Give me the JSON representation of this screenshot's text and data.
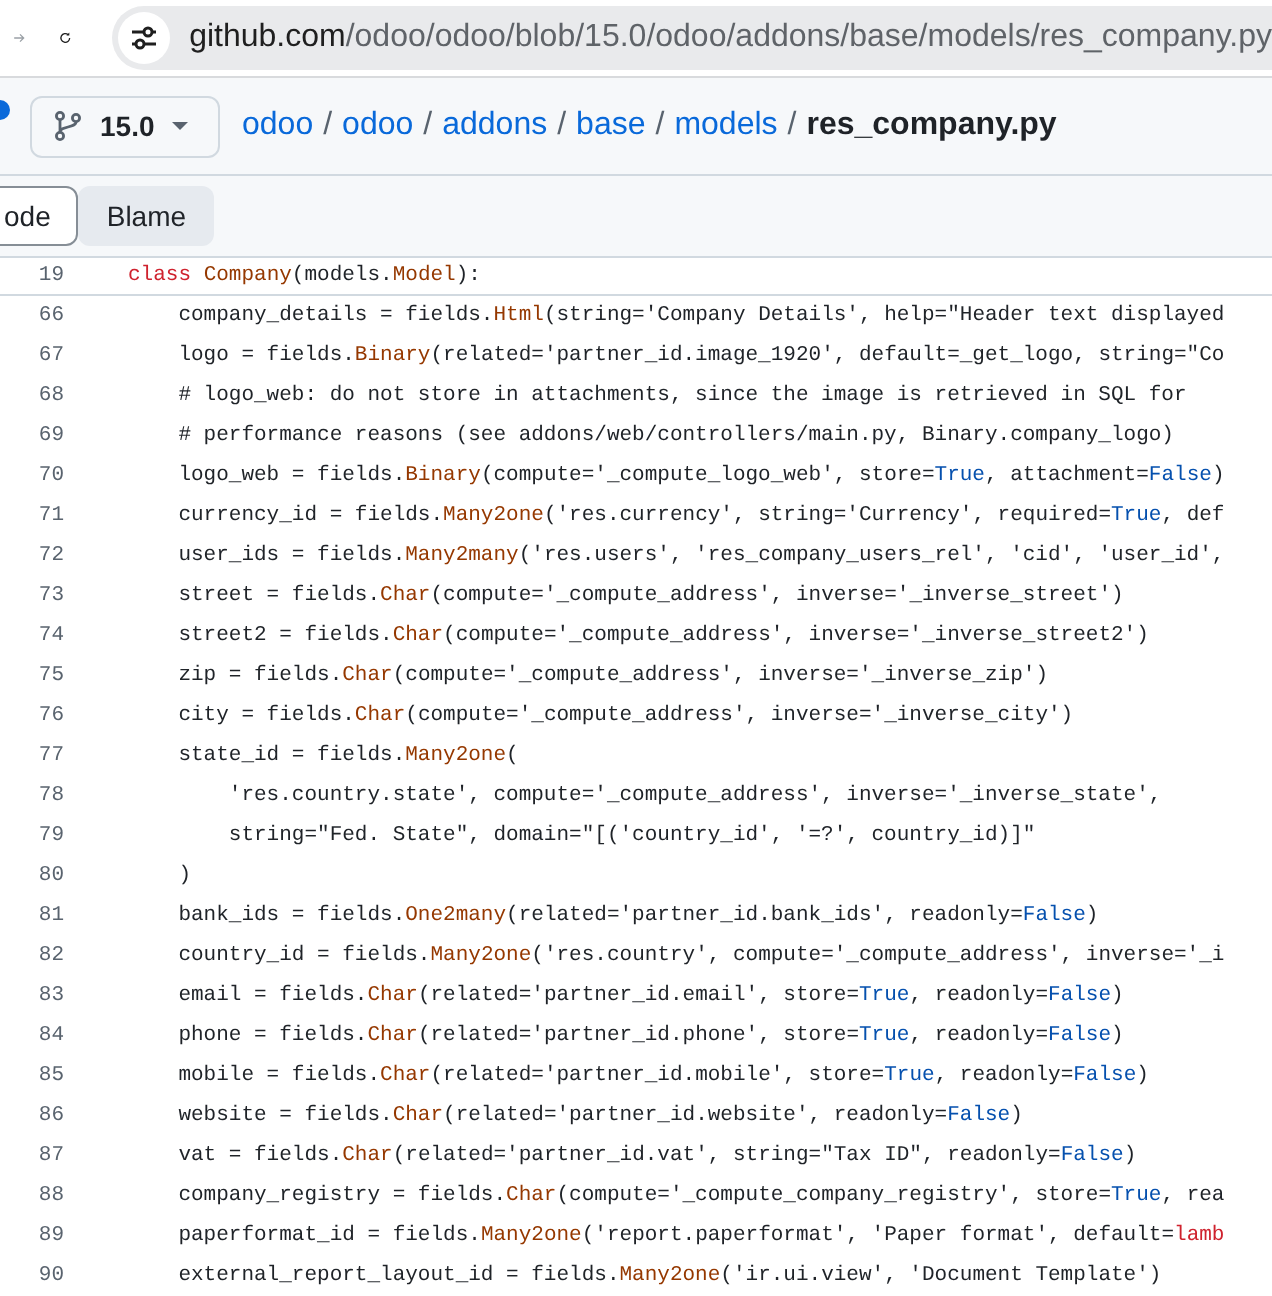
{
  "browser": {
    "host": "github.com",
    "path": "/odoo/odoo/blob/15.0/odoo/addons/base/models/res_company.py"
  },
  "repo_header": {
    "branch": "15.0",
    "separator": "/",
    "breadcrumb": [
      {
        "label": "odoo",
        "kind": "link"
      },
      {
        "label": "odoo",
        "kind": "link"
      },
      {
        "label": "addons",
        "kind": "link"
      },
      {
        "label": "base",
        "kind": "link"
      },
      {
        "label": "models",
        "kind": "link"
      },
      {
        "label": "res_company.py",
        "kind": "current"
      }
    ]
  },
  "tabs": [
    {
      "label": "ode",
      "selected": true
    },
    {
      "label": "Blame",
      "selected": false
    }
  ],
  "sticky_line": {
    "number": "19",
    "tokens": [
      {
        "kind": "keyword",
        "text": "class "
      },
      {
        "kind": "function",
        "text": "Company"
      },
      {
        "kind": "plain",
        "text": "(models."
      },
      {
        "kind": "function",
        "text": "Model"
      },
      {
        "kind": "plain",
        "text": "):"
      }
    ]
  },
  "code_lines": [
    {
      "number": "66",
      "tokens": [
        {
          "kind": "plain",
          "text": "    company_details = fields."
        },
        {
          "kind": "function",
          "text": "Html"
        },
        {
          "kind": "plain",
          "text": "(string='Company Details', help=\"Header text displayed"
        }
      ]
    },
    {
      "number": "67",
      "tokens": [
        {
          "kind": "plain",
          "text": "    logo = fields."
        },
        {
          "kind": "function",
          "text": "Binary"
        },
        {
          "kind": "plain",
          "text": "(related='partner_id.image_1920', default=_get_logo, string=\"Co"
        }
      ]
    },
    {
      "number": "68",
      "tokens": [
        {
          "kind": "plain",
          "text": "    # logo_web: do not store in attachments, since the image is retrieved in SQL for"
        }
      ]
    },
    {
      "number": "69",
      "tokens": [
        {
          "kind": "plain",
          "text": "    # performance reasons (see addons/web/controllers/main.py, Binary.company_logo)"
        }
      ]
    },
    {
      "number": "70",
      "tokens": [
        {
          "kind": "plain",
          "text": "    logo_web = fields."
        },
        {
          "kind": "function",
          "text": "Binary"
        },
        {
          "kind": "plain",
          "text": "(compute='_compute_logo_web', store="
        },
        {
          "kind": "constant",
          "text": "True"
        },
        {
          "kind": "plain",
          "text": ", attachment="
        },
        {
          "kind": "constant",
          "text": "False"
        },
        {
          "kind": "plain",
          "text": ")"
        }
      ]
    },
    {
      "number": "71",
      "tokens": [
        {
          "kind": "plain",
          "text": "    currency_id = fields."
        },
        {
          "kind": "function",
          "text": "Many2one"
        },
        {
          "kind": "plain",
          "text": "('res.currency', string='Currency', required="
        },
        {
          "kind": "constant",
          "text": "True"
        },
        {
          "kind": "plain",
          "text": ", def"
        }
      ]
    },
    {
      "number": "72",
      "tokens": [
        {
          "kind": "plain",
          "text": "    user_ids = fields."
        },
        {
          "kind": "function",
          "text": "Many2many"
        },
        {
          "kind": "plain",
          "text": "('res.users', 'res_company_users_rel', 'cid', 'user_id',"
        }
      ]
    },
    {
      "number": "73",
      "tokens": [
        {
          "kind": "plain",
          "text": "    street = fields."
        },
        {
          "kind": "function",
          "text": "Char"
        },
        {
          "kind": "plain",
          "text": "(compute='_compute_address', inverse='_inverse_street')"
        }
      ]
    },
    {
      "number": "74",
      "tokens": [
        {
          "kind": "plain",
          "text": "    street2 = fields."
        },
        {
          "kind": "function",
          "text": "Char"
        },
        {
          "kind": "plain",
          "text": "(compute='_compute_address', inverse='_inverse_street2')"
        }
      ]
    },
    {
      "number": "75",
      "tokens": [
        {
          "kind": "plain",
          "text": "    zip = fields."
        },
        {
          "kind": "function",
          "text": "Char"
        },
        {
          "kind": "plain",
          "text": "(compute='_compute_address', inverse='_inverse_zip')"
        }
      ]
    },
    {
      "number": "76",
      "tokens": [
        {
          "kind": "plain",
          "text": "    city = fields."
        },
        {
          "kind": "function",
          "text": "Char"
        },
        {
          "kind": "plain",
          "text": "(compute='_compute_address', inverse='_inverse_city')"
        }
      ]
    },
    {
      "number": "77",
      "tokens": [
        {
          "kind": "plain",
          "text": "    state_id = fields."
        },
        {
          "kind": "function",
          "text": "Many2one"
        },
        {
          "kind": "plain",
          "text": "("
        }
      ]
    },
    {
      "number": "78",
      "tokens": [
        {
          "kind": "plain",
          "text": "        'res.country.state', compute='_compute_address', inverse='_inverse_state',"
        }
      ]
    },
    {
      "number": "79",
      "tokens": [
        {
          "kind": "plain",
          "text": "        string=\"Fed. State\", domain=\"[('country_id', '=?', country_id)]\""
        }
      ]
    },
    {
      "number": "80",
      "tokens": [
        {
          "kind": "plain",
          "text": "    )"
        }
      ]
    },
    {
      "number": "81",
      "tokens": [
        {
          "kind": "plain",
          "text": "    bank_ids = fields."
        },
        {
          "kind": "function",
          "text": "One2many"
        },
        {
          "kind": "plain",
          "text": "(related='partner_id.bank_ids', readonly="
        },
        {
          "kind": "constant",
          "text": "False"
        },
        {
          "kind": "plain",
          "text": ")"
        }
      ]
    },
    {
      "number": "82",
      "tokens": [
        {
          "kind": "plain",
          "text": "    country_id = fields."
        },
        {
          "kind": "function",
          "text": "Many2one"
        },
        {
          "kind": "plain",
          "text": "('res.country', compute='_compute_address', inverse='_i"
        }
      ]
    },
    {
      "number": "83",
      "tokens": [
        {
          "kind": "plain",
          "text": "    email = fields."
        },
        {
          "kind": "function",
          "text": "Char"
        },
        {
          "kind": "plain",
          "text": "(related='partner_id.email', store="
        },
        {
          "kind": "constant",
          "text": "True"
        },
        {
          "kind": "plain",
          "text": ", readonly="
        },
        {
          "kind": "constant",
          "text": "False"
        },
        {
          "kind": "plain",
          "text": ")"
        }
      ]
    },
    {
      "number": "84",
      "tokens": [
        {
          "kind": "plain",
          "text": "    phone = fields."
        },
        {
          "kind": "function",
          "text": "Char"
        },
        {
          "kind": "plain",
          "text": "(related='partner_id.phone', store="
        },
        {
          "kind": "constant",
          "text": "True"
        },
        {
          "kind": "plain",
          "text": ", readonly="
        },
        {
          "kind": "constant",
          "text": "False"
        },
        {
          "kind": "plain",
          "text": ")"
        }
      ]
    },
    {
      "number": "85",
      "tokens": [
        {
          "kind": "plain",
          "text": "    mobile = fields."
        },
        {
          "kind": "function",
          "text": "Char"
        },
        {
          "kind": "plain",
          "text": "(related='partner_id.mobile', store="
        },
        {
          "kind": "constant",
          "text": "True"
        },
        {
          "kind": "plain",
          "text": ", readonly="
        },
        {
          "kind": "constant",
          "text": "False"
        },
        {
          "kind": "plain",
          "text": ")"
        }
      ]
    },
    {
      "number": "86",
      "tokens": [
        {
          "kind": "plain",
          "text": "    website = fields."
        },
        {
          "kind": "function",
          "text": "Char"
        },
        {
          "kind": "plain",
          "text": "(related='partner_id.website', readonly="
        },
        {
          "kind": "constant",
          "text": "False"
        },
        {
          "kind": "plain",
          "text": ")"
        }
      ]
    },
    {
      "number": "87",
      "tokens": [
        {
          "kind": "plain",
          "text": "    vat = fields."
        },
        {
          "kind": "function",
          "text": "Char"
        },
        {
          "kind": "plain",
          "text": "(related='partner_id.vat', string=\"Tax ID\", readonly="
        },
        {
          "kind": "constant",
          "text": "False"
        },
        {
          "kind": "plain",
          "text": ")"
        }
      ]
    },
    {
      "number": "88",
      "tokens": [
        {
          "kind": "plain",
          "text": "    company_registry = fields."
        },
        {
          "kind": "function",
          "text": "Char"
        },
        {
          "kind": "plain",
          "text": "(compute='_compute_company_registry', store="
        },
        {
          "kind": "constant",
          "text": "True"
        },
        {
          "kind": "plain",
          "text": ", rea"
        }
      ]
    },
    {
      "number": "89",
      "tokens": [
        {
          "kind": "plain",
          "text": "    paperformat_id = fields."
        },
        {
          "kind": "function",
          "text": "Many2one"
        },
        {
          "kind": "plain",
          "text": "('report.paperformat', 'Paper format', default="
        },
        {
          "kind": "keyword",
          "text": "lamb"
        }
      ]
    },
    {
      "number": "90",
      "tokens": [
        {
          "kind": "plain",
          "text": "    external_report_layout_id = fields."
        },
        {
          "kind": "function",
          "text": "Many2one"
        },
        {
          "kind": "plain",
          "text": "('ir.ui.view', 'Document Template')"
        }
      ]
    }
  ]
}
